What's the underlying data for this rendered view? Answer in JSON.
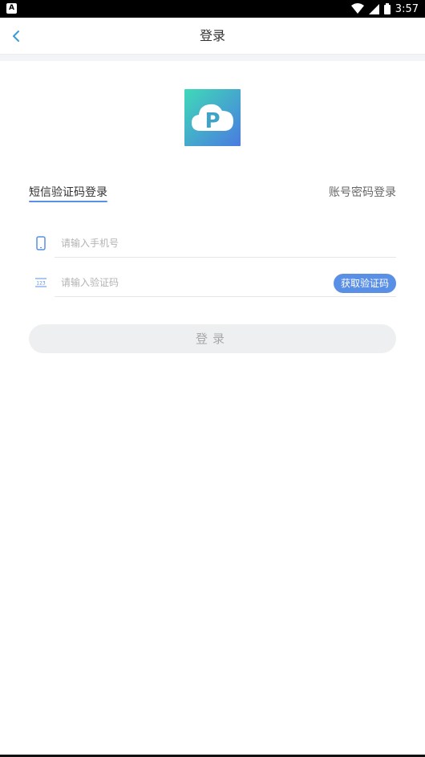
{
  "status_bar": {
    "time": "3:57",
    "left_icon": "A"
  },
  "header": {
    "title": "登录",
    "back_icon": "chevron-left-icon"
  },
  "logo": {
    "letter": "P",
    "colors": {
      "gradient_start": "#3fd9b8",
      "gradient_end": "#4a7be0"
    }
  },
  "tabs": {
    "sms_label": "短信验证码登录",
    "password_label": "账号密码登录",
    "active": "sms"
  },
  "form": {
    "phone_placeholder": "请输入手机号",
    "phone_value": "",
    "code_placeholder": "请输入验证码",
    "code_value": "",
    "get_code_label": "获取验证码",
    "code_icon_text": "123"
  },
  "login_button": {
    "label": "登录"
  },
  "colors": {
    "accent": "#5a8fe6",
    "back_arrow": "#3a9ad9",
    "disabled_button_bg": "#eeeff1"
  }
}
